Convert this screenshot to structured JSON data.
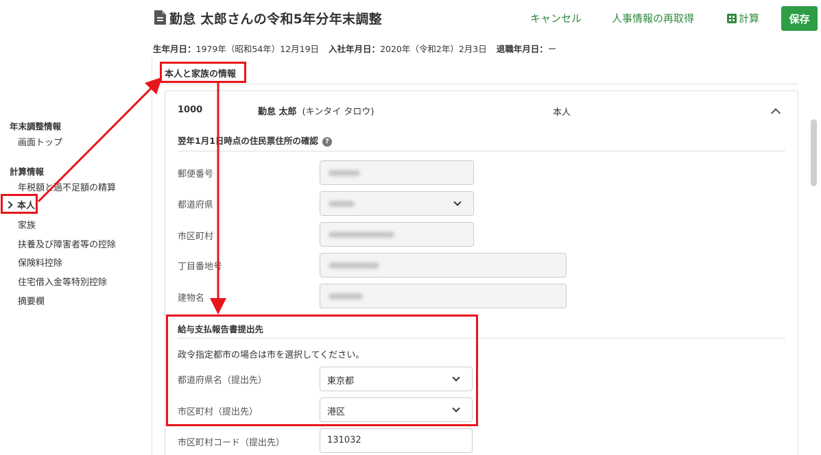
{
  "header": {
    "title": "勤怠 太郎さんの令和5年分年末調整",
    "cancel_label": "キャンセル",
    "refetch_label": "人事情報の再取得",
    "calc_label": "計算",
    "save_label": "保存",
    "accent_color": "#2e9e45"
  },
  "employee_info": {
    "birth_label": "生年月日：",
    "birth_value": "1979年（昭和54年）12月19日",
    "join_label": "入社年月日：",
    "join_value": "2020年（令和2年）2月3日",
    "retire_label": "退職年月日：",
    "retire_value": "ー"
  },
  "sidebar": {
    "groups": [
      {
        "heading": "年末調整情報",
        "items": [
          "画面トップ"
        ]
      },
      {
        "heading": "計算情報",
        "items": [
          "年税額と過不足額の精算",
          "本人",
          "家族",
          "扶養及び障害者等の控除",
          "保険料控除",
          "住宅借入金等特別控除",
          "摘要欄"
        ]
      }
    ],
    "active": "本人"
  },
  "section": {
    "title": "本人と家族の情報"
  },
  "card": {
    "employee_no": "1000",
    "name": "勤怠 太郎",
    "kana": "(キンタイ タロウ)",
    "relation": "本人",
    "address": {
      "title": "翌年1月1日時点の住民票住所の確認",
      "help_icon": "question-circle-icon",
      "fields": [
        {
          "label": "郵便番号"
        },
        {
          "label": "都道府県"
        },
        {
          "label": "市区町村"
        },
        {
          "label": "丁目番地号"
        },
        {
          "label": "建物名"
        }
      ]
    },
    "report": {
      "title": "給与支払報告書提出先",
      "note": "政令指定都市の場合は市を選択してください。",
      "fields": [
        {
          "label": "都道府県名（提出先）",
          "value": "東京都"
        },
        {
          "label": "市区町村（提出先）",
          "value": "港区"
        },
        {
          "label": "市区町村コード（提出先）",
          "value": "131032"
        }
      ]
    }
  },
  "annotation_color": "#e8141c"
}
